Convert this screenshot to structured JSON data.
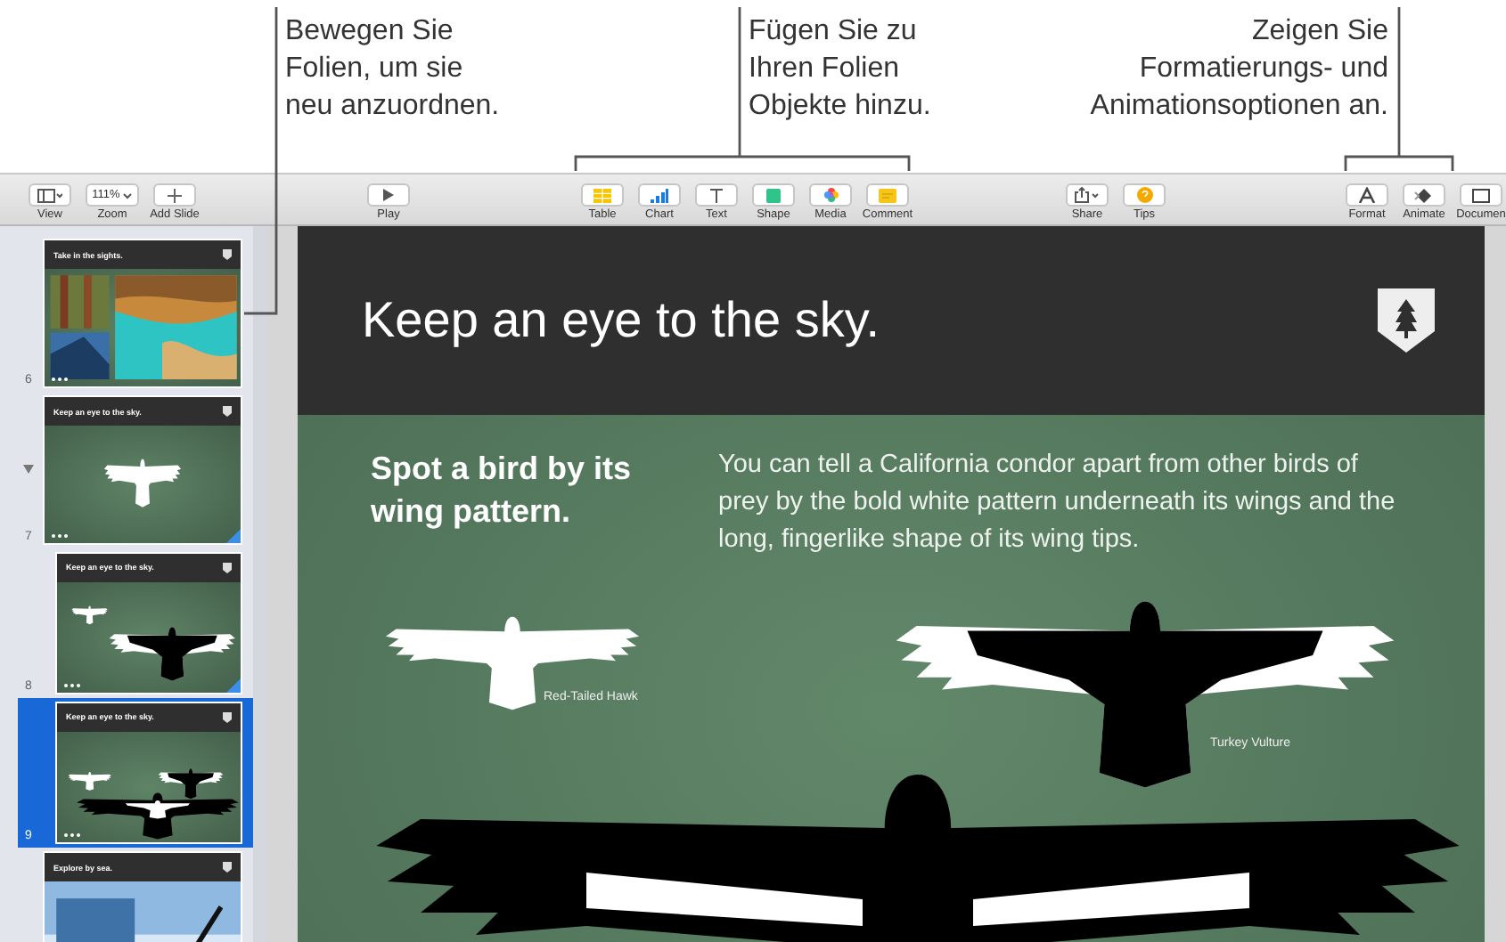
{
  "callouts": [
    {
      "lines": [
        "Bewegen Sie",
        "Folien, um sie",
        "neu anzuordnen."
      ]
    },
    {
      "lines": [
        "Fügen Sie zu",
        "Ihren Folien",
        "Objekte hinzu."
      ]
    },
    {
      "lines": [
        "Zeigen Sie",
        "Formatierungs- und",
        "Animationsoptionen an."
      ]
    }
  ],
  "toolbar": {
    "groups": [
      [
        {
          "kind": "view",
          "label": "View"
        },
        {
          "kind": "zoom",
          "label": "Zoom",
          "value": "111%"
        },
        {
          "kind": "add",
          "label": "Add Slide"
        }
      ],
      [
        {
          "kind": "play",
          "label": "Play"
        }
      ],
      [
        {
          "kind": "table",
          "label": "Table"
        },
        {
          "kind": "chart",
          "label": "Chart"
        },
        {
          "kind": "text",
          "label": "Text"
        },
        {
          "kind": "shape",
          "label": "Shape"
        },
        {
          "kind": "media",
          "label": "Media"
        },
        {
          "kind": "comment",
          "label": "Comment"
        }
      ],
      [
        {
          "kind": "share",
          "label": "Share"
        },
        {
          "kind": "tips",
          "label": "Tips"
        }
      ],
      [
        {
          "kind": "format",
          "label": "Format"
        },
        {
          "kind": "animate",
          "label": "Animate"
        },
        {
          "kind": "document",
          "label": "Documen"
        }
      ]
    ]
  },
  "navigator": {
    "slides": [
      {
        "number": "6",
        "title": "Take in the sights.",
        "kind": "photos",
        "selected": false,
        "corner_flag": false
      },
      {
        "number": "7",
        "title": "Keep an eye to the sky.",
        "kind": "birds1",
        "selected": false,
        "corner_flag": true,
        "expanded": true,
        "children": [
          {
            "number": "8",
            "title": "Keep an eye to the sky.",
            "kind": "birds2",
            "selected": false,
            "corner_flag": true
          },
          {
            "number": "9",
            "title": "Keep an eye to the sky.",
            "kind": "birds3",
            "selected": true,
            "corner_flag": false
          }
        ]
      },
      {
        "title": "Explore by sea.",
        "kind": "sea",
        "selected": false,
        "corner_flag": false
      }
    ]
  },
  "slide": {
    "title": "Keep an eye to the sky.",
    "heading": "Spot a bird by its wing pattern.",
    "paragraph": "You can tell a California condor apart from other birds of prey by the bold white pattern underneath its wings and the long, fingerlike shape of its wing tips.",
    "labels": [
      "Red-Tailed Hawk",
      "Turkey Vulture"
    ]
  }
}
